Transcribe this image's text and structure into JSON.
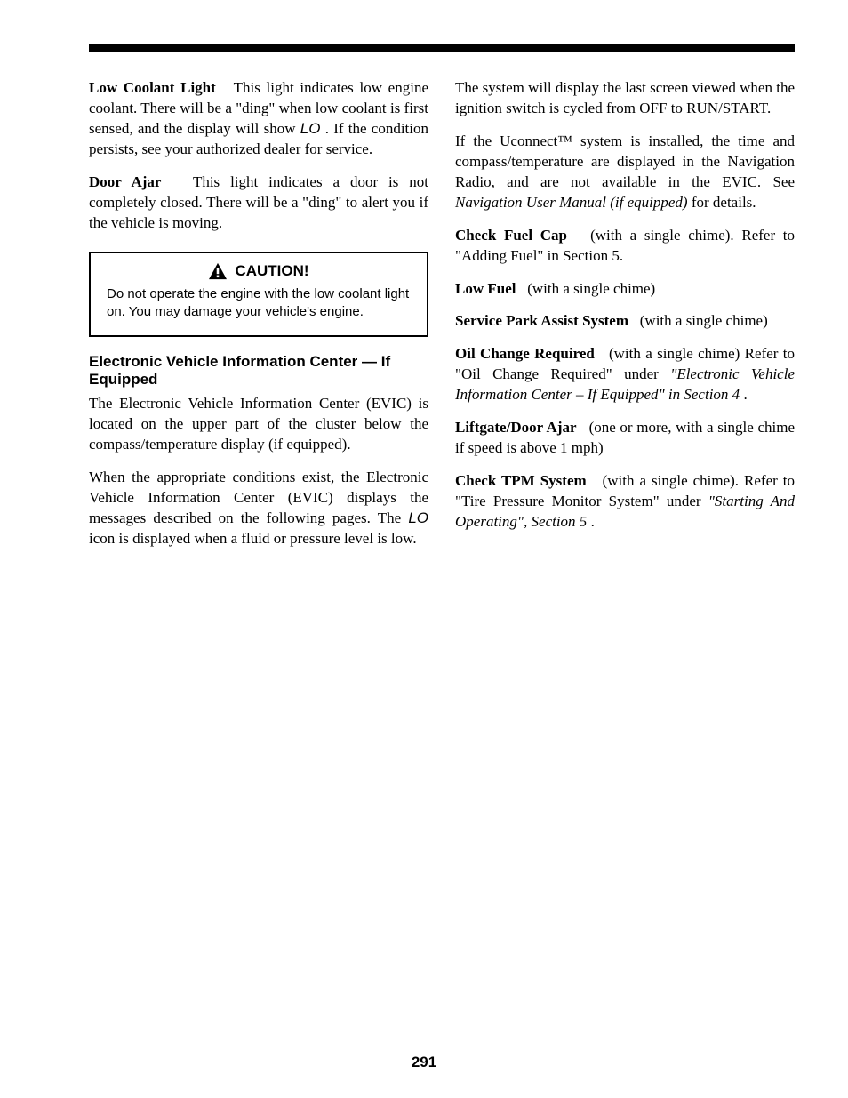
{
  "page_number": "291",
  "left": {
    "p1_lead_bold": "Low Coolant Light",
    "p1_rest_a": "This light indicates low engine coolant. There will be a \"ding\" when low coolant is first sensed, and the display will show ",
    "p1_seg": "LO",
    "p1_rest_b": ". If the condition persists, see your authorized dealer for service.",
    "p2_lead_bold": "Door Ajar",
    "p2_rest": "This light indicates a door is not completely closed. There will be a \"ding\" to alert you if the vehicle is moving.",
    "caution_heading": "CAUTION!",
    "caution_body": "Do not operate the engine with the low coolant light on. You may damage your vehicle's engine.",
    "subhead": "Electronic Vehicle Information Center — If Equipped",
    "p3": "The Electronic Vehicle Information Center (EVIC) is located on the upper part of the cluster below the compass/temperature display (if equipped).",
    "p4_a": "When the appropriate conditions exist, the Electronic Vehicle Information Center (EVIC) displays the messages described on the following pages. The ",
    "p4_seg": "LO",
    "p4_b": " icon is displayed when a fluid or pressure level is low."
  },
  "right": {
    "r1": "The system will display the last screen viewed when the ignition switch is cycled from OFF to RUN/START.",
    "r2_a": "If the Uconnect™ system is installed, the time and compass/temperature are displayed in the Navigation Radio, and are not available in the EVIC. See ",
    "r2_ital": "Navigation User Manual (if equipped)",
    "r2_b": " for details.",
    "r3_lead_bold": "Check Fuel Cap",
    "r3_rest": "(with a single chime). Refer to \"Adding Fuel\" in Section 5.",
    "r4_lead_bold": "Low Fuel",
    "r4_rest": "(with a single chime)",
    "r5_lead_bold": "Service Park Assist System",
    "r5_rest": "(with a single chime)",
    "r6_lead_bold": "Oil Change Required",
    "r6_rest_a": "(with a single chime) Refer to \"Oil Change Required\" under ",
    "r6_ital": "\"Electronic Vehicle Information Center – If Equipped\" in Section 4",
    "r6_rest_b": ".",
    "r7_lead_bold": "Liftgate/Door Ajar",
    "r7_rest": "(one or more, with a single chime if speed is above 1 mph)",
    "r8_lead_bold": "Check TPM System",
    "r8_rest_a": "(with a single chime). Refer to \"Tire Pressure Monitor System\" under ",
    "r8_ital": "\"Starting And Operating\", Section 5",
    "r8_rest_b": "."
  }
}
